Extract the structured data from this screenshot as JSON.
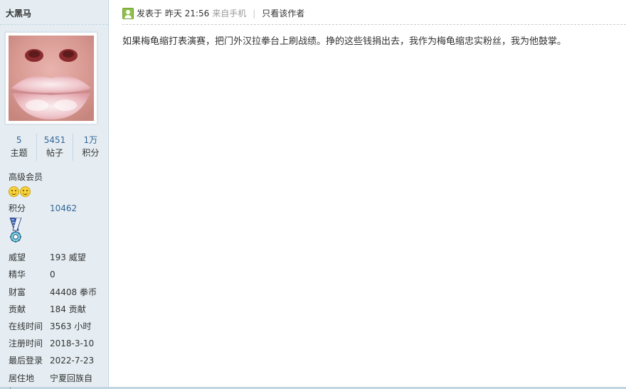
{
  "sidebar": {
    "username": "大黑马",
    "stats": [
      {
        "value": "5",
        "label": "主题"
      },
      {
        "value": "5451",
        "label": "帖子"
      },
      {
        "value": "1万",
        "label": "积分"
      }
    ],
    "group": "高级会员",
    "info": [
      {
        "key": "积分",
        "value": "10462"
      },
      {
        "key": "威望",
        "value": "193 威望"
      },
      {
        "key": "精华",
        "value": "0"
      },
      {
        "key": "财富",
        "value": "44408 拳币"
      },
      {
        "key": "贡献",
        "value": "184 贡献"
      },
      {
        "key": "在线时间",
        "value": "3563 小时"
      },
      {
        "key": "注册时间",
        "value": "2018-3-10"
      },
      {
        "key": "最后登录",
        "value": "2022-7-23"
      },
      {
        "key": "居住地",
        "value": "宁夏回族自"
      }
    ],
    "icons": {
      "online": "online-user-icon",
      "medal": "medal-icon",
      "smiley": "smiley-icon"
    }
  },
  "post": {
    "meta_prefix": "发表于 昨天 21:56",
    "meta_from": "来自手机",
    "separator": "|",
    "only_author": "只看该作者",
    "content": "如果梅龟缩打表演赛，把门外汉拉拳台上刷战绩。挣的这些钱捐出去，我作为梅龟缩忠实粉丝，我为他鼓掌。"
  },
  "colors": {
    "sidebar_bg": "#e5edf2",
    "link": "#336699",
    "border": "#c2d5e3"
  }
}
